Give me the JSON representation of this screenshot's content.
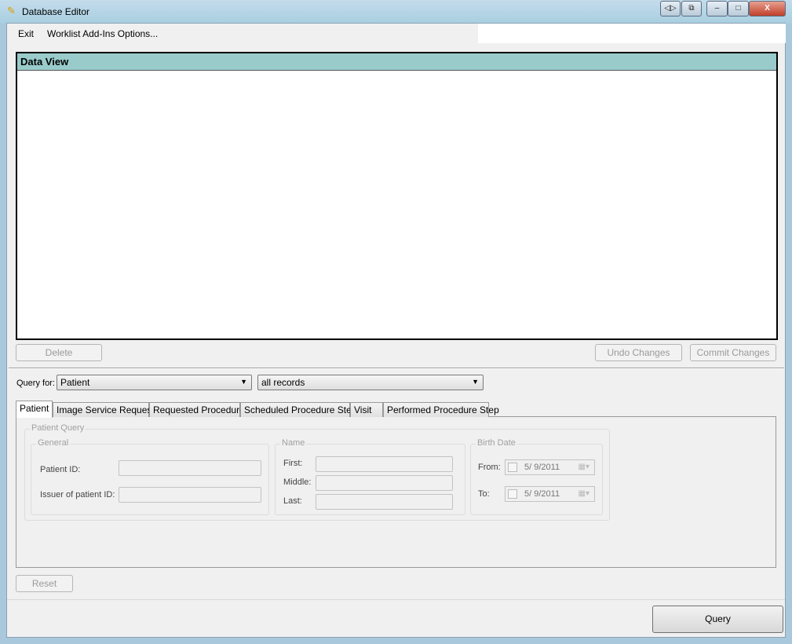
{
  "window": {
    "title": "Database Editor",
    "controls": [
      "◁▷",
      "⧉",
      "–",
      "□",
      "X"
    ]
  },
  "menu": {
    "items": [
      "Exit",
      "Worklist Add-Ins Options..."
    ]
  },
  "data_view": {
    "title": "Data View"
  },
  "buttons": {
    "delete": "Delete",
    "undo": "Undo Changes",
    "commit": "Commit Changes",
    "reset": "Reset",
    "query": "Query"
  },
  "query": {
    "label": "Query for:",
    "entity": "Patient",
    "filter": "all records"
  },
  "tabs": [
    "Patient",
    "Image Service Request",
    "Requested Procedure",
    "Scheduled Procedure Step",
    "Visit",
    "Performed Procedure Step"
  ],
  "patient_query": {
    "title": "Patient Query",
    "general": {
      "title": "General",
      "patient_id": "Patient ID:",
      "issuer": "Issuer of patient ID:"
    },
    "name": {
      "title": "Name",
      "first": "First:",
      "middle": "Middle:",
      "last": "Last:"
    },
    "birth_date": {
      "title": "Birth Date",
      "from": "From:",
      "to": "To:",
      "from_value": "5/ 9/2011",
      "to_value": "5/ 9/2011"
    }
  }
}
